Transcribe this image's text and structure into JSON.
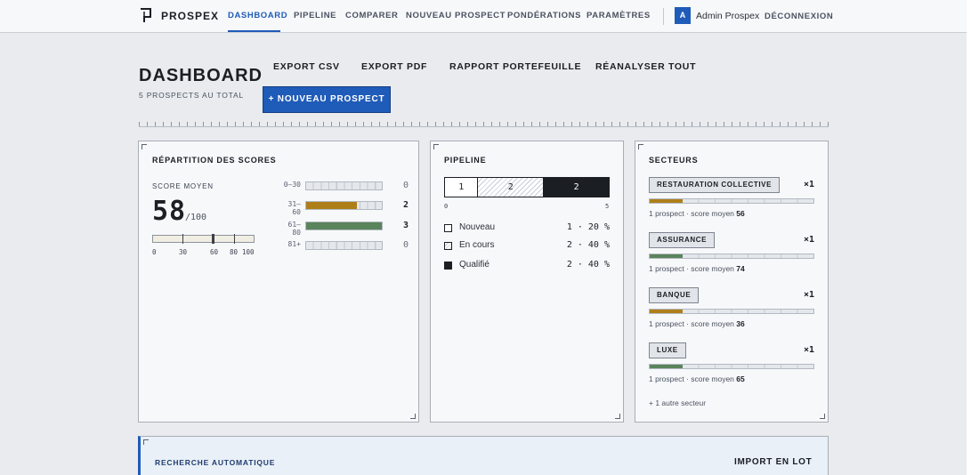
{
  "app": {
    "brand": "PROSPEX"
  },
  "nav": {
    "items": [
      "DASHBOARD",
      "PIPELINE",
      "COMPARER",
      "NOUVEAU PROSPECT",
      "PONDÉRATIONS",
      "PARAMÈTRES"
    ],
    "active": "DASHBOARD",
    "user_initial": "A",
    "user_name": "Admin Prospex",
    "logout": "DÉCONNEXION"
  },
  "header": {
    "title": "DASHBOARD",
    "subtitle": "5 PROSPECTS AU TOTAL",
    "actions": [
      "EXPORT CSV",
      "EXPORT PDF",
      "RAPPORT PORTEFEUILLE",
      "RÉANALYSER TOUT"
    ],
    "new_button": "+ NOUVEAU PROSPECT"
  },
  "scores": {
    "title": "RÉPARTITION DES SCORES",
    "avg_label": "SCORE MOYEN",
    "avg_value": "58",
    "avg_unit": "/100",
    "gauge_scale": [
      "0",
      "30",
      "60",
      "80",
      "100"
    ],
    "buckets": [
      {
        "label": "0–30",
        "count": "0",
        "fraction": 0,
        "color": "#b5851c"
      },
      {
        "label": "31–60",
        "count": "2",
        "fraction": 0.667,
        "color": "#ae7f19"
      },
      {
        "label": "61–80",
        "count": "3",
        "fraction": 1.0,
        "color": "#5a845c"
      },
      {
        "label": "81+",
        "count": "0",
        "fraction": 0,
        "color": "#5a845c"
      }
    ]
  },
  "pipeline": {
    "title": "PIPELINE",
    "scale_min": "0",
    "scale_max": "5",
    "segments": [
      {
        "value": "1",
        "style": "white"
      },
      {
        "value": "2",
        "style": "hatched"
      },
      {
        "value": "2",
        "style": "dark"
      }
    ],
    "legend": [
      {
        "label": "Nouveau",
        "value": "1 · 20 %"
      },
      {
        "label": "En cours",
        "value": "2 · 40 %"
      },
      {
        "label": "Qualifié",
        "value": "2 · 40 %"
      }
    ]
  },
  "sectors": {
    "title": "SECTEURS",
    "items": [
      {
        "name": "RESTAURATION COLLECTIVE",
        "mult": "×1",
        "info": "1 prospect · score moyen",
        "score": "56",
        "fraction": 0.2,
        "color": "#ae7f19"
      },
      {
        "name": "ASSURANCE",
        "mult": "×1",
        "info": "1 prospect · score moyen",
        "score": "74",
        "fraction": 0.2,
        "color": "#5a845c"
      },
      {
        "name": "BANQUE",
        "mult": "×1",
        "info": "1 prospect · score moyen",
        "score": "36",
        "fraction": 0.2,
        "color": "#ae7f19"
      },
      {
        "name": "LUXE",
        "mult": "×1",
        "info": "1 prospect · score moyen",
        "score": "65",
        "fraction": 0.2,
        "color": "#5a845c"
      }
    ],
    "more": "+ 1 autre secteur"
  },
  "bottom": {
    "title": "RECHERCHE AUTOMATIQUE",
    "import": "IMPORT EN LOT"
  }
}
